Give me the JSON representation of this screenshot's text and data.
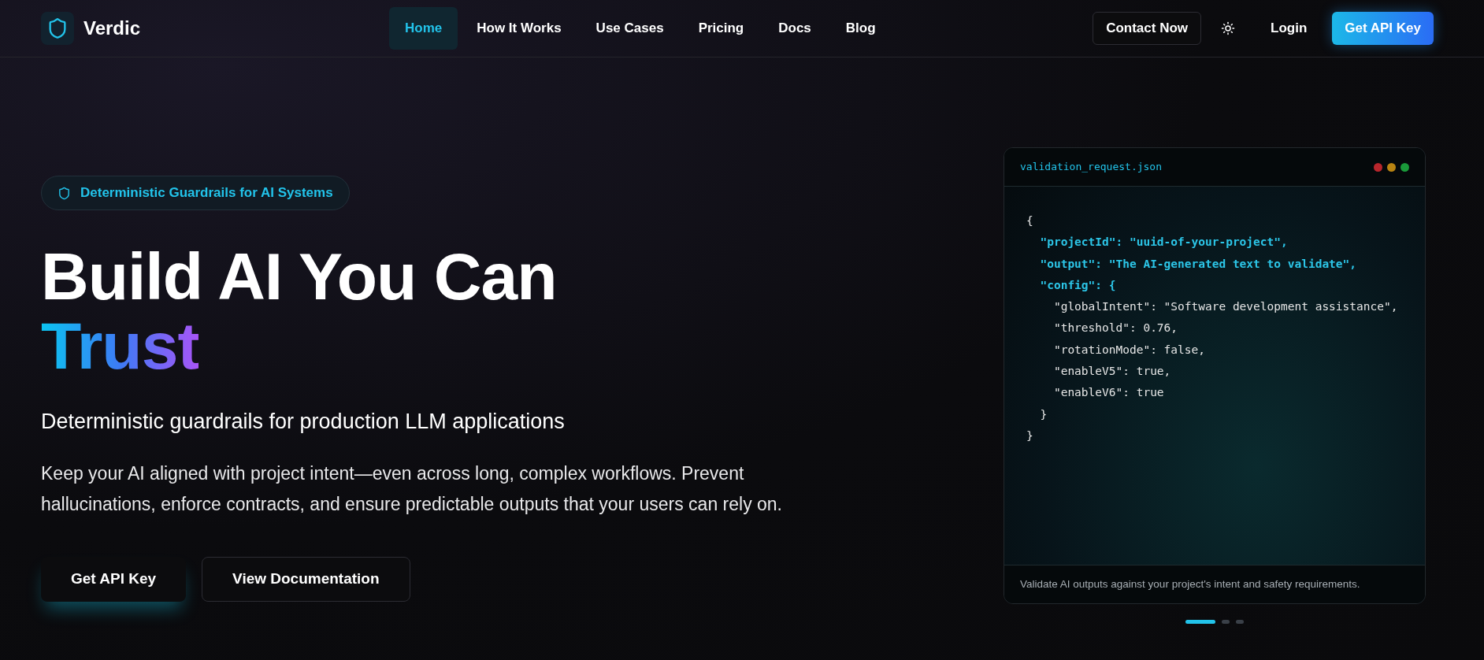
{
  "brand": {
    "name": "Verdic"
  },
  "nav": [
    {
      "label": "Home",
      "selected": true
    },
    {
      "label": "How It Works",
      "selected": false
    },
    {
      "label": "Use Cases",
      "selected": false
    },
    {
      "label": "Pricing",
      "selected": false
    },
    {
      "label": "Docs",
      "selected": false
    },
    {
      "label": "Blog",
      "selected": false
    }
  ],
  "header_actions": {
    "contact": "Contact Now",
    "login": "Login",
    "cta": "Get API Key"
  },
  "hero": {
    "badge": "Deterministic Guardrails for AI Systems",
    "title": "Build AI You Can",
    "title_accent": "Trust",
    "subtitle": "Deterministic guardrails for production LLM applications",
    "description": "Keep your AI aligned with project intent—even across long, complex workflows. Prevent hallucinations, enforce contracts, and ensure predictable outputs that your users can rely on.",
    "buttons": [
      {
        "label": "Get API Key",
        "kind": "glow"
      },
      {
        "label": "View Documentation",
        "kind": "outline"
      }
    ]
  },
  "code_card": {
    "filename": "validation_request.json",
    "lines": [
      {
        "text": "{",
        "kind": "plain"
      },
      {
        "text": "  \"projectId\": \"uuid-of-your-project\",",
        "kind": "highlight"
      },
      {
        "text": "  \"output\": \"The AI-generated text to validate\",",
        "kind": "highlight"
      },
      {
        "text": "  \"config\": {",
        "kind": "highlight"
      },
      {
        "text": "    \"globalIntent\": \"Software development assistance\",",
        "kind": "plain"
      },
      {
        "text": "    \"threshold\": 0.76,",
        "kind": "plain"
      },
      {
        "text": "    \"rotationMode\": false,",
        "kind": "plain"
      },
      {
        "text": "    \"enableV5\": true,",
        "kind": "plain"
      },
      {
        "text": "    \"enableV6\": true",
        "kind": "plain"
      },
      {
        "text": "  }",
        "kind": "plain"
      },
      {
        "text": "}",
        "kind": "plain"
      }
    ],
    "caption": "Validate AI outputs against your project's intent and safety requirements."
  },
  "carousel": [
    {
      "selected": true
    },
    {
      "selected": false
    },
    {
      "selected": false
    }
  ]
}
